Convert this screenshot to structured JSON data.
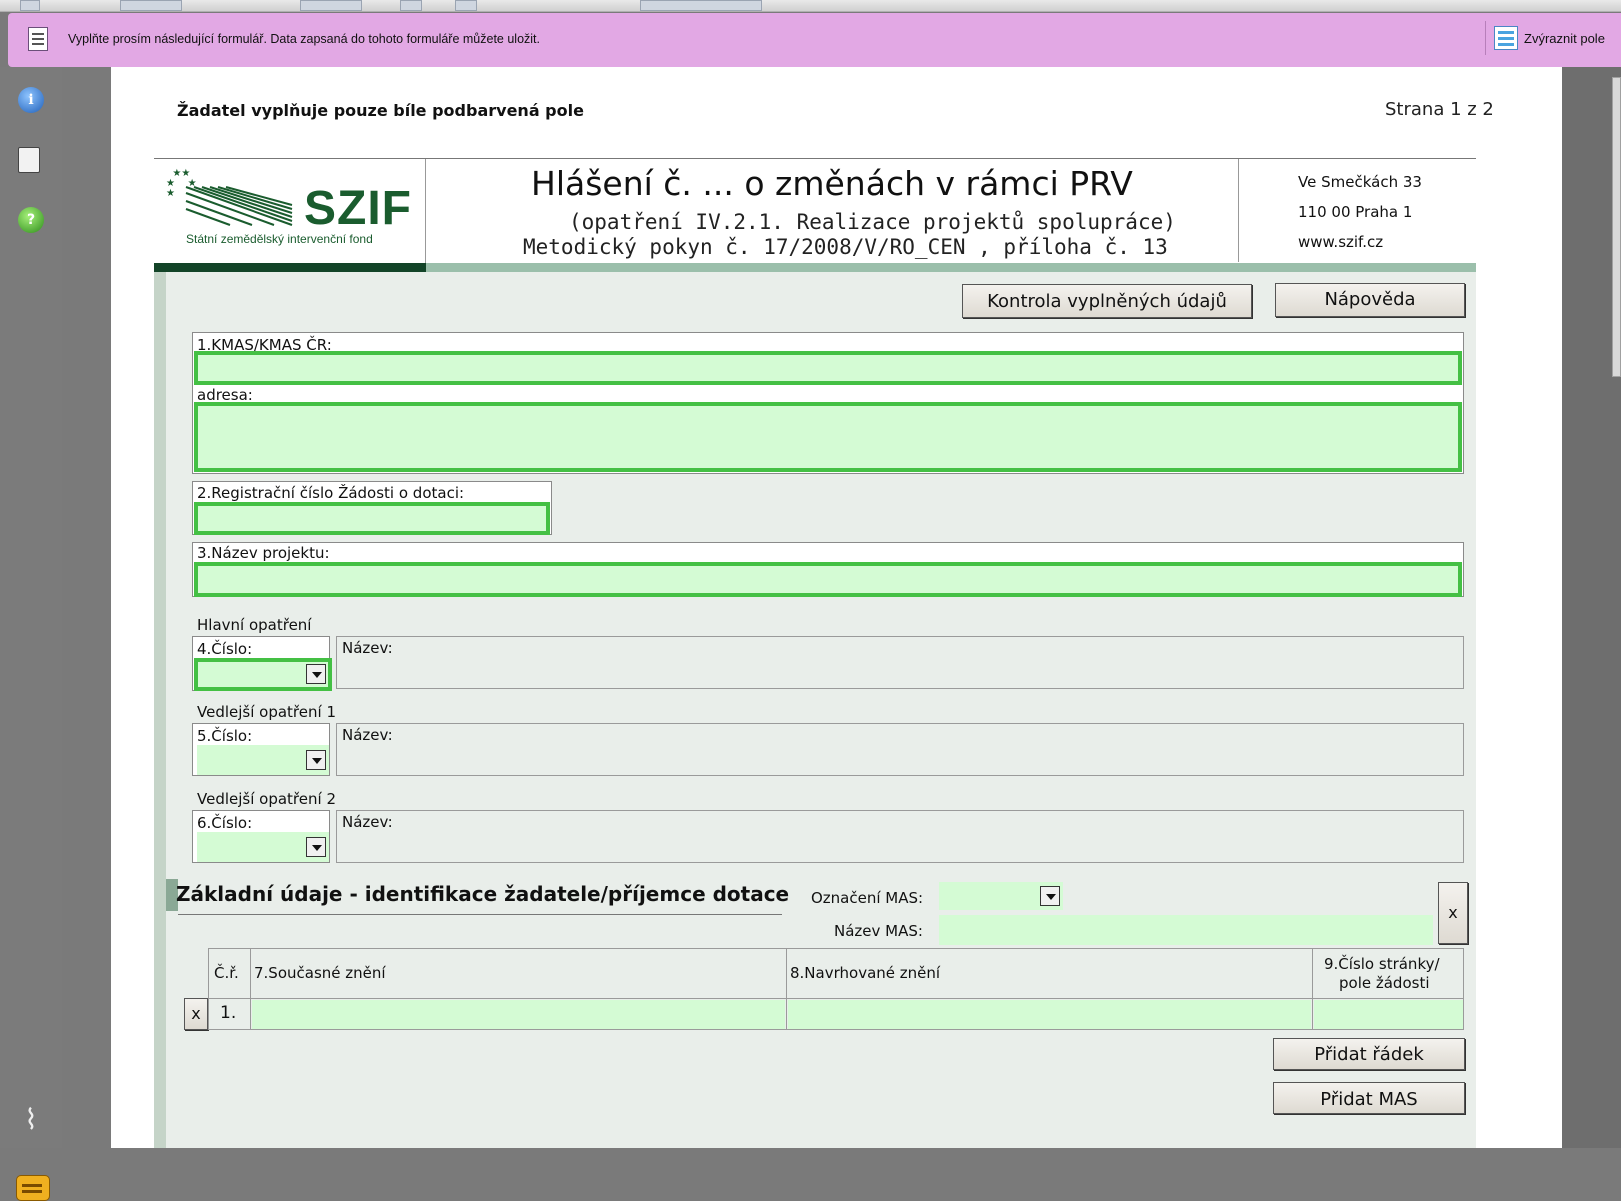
{
  "notice": {
    "text": "Vyplňte prosím následující formulář. Data zapsaná do tohoto formuláře můžete uložit.",
    "highlight_label": "Zvýraznit pole"
  },
  "page": {
    "note": "Žadatel vyplňuje pouze bíle podbarvená pole",
    "page_number": "Strana 1 z 2"
  },
  "logo": {
    "name": "SZIF",
    "subtitle": "Státní zemědělský intervenční fond"
  },
  "header": {
    "title": "Hlášení č. ... o změnách v rámci PRV",
    "subtitle1": "(opatření IV.2.1. Realizace projektů spolupráce)",
    "subtitle2": "Metodický pokyn č. 17/2008/V/RO_CEN , příloha č. 13",
    "address": [
      "Ve Smečkách 33",
      "110 00 Praha 1",
      "www.szif.cz"
    ]
  },
  "buttons": {
    "check": "Kontrola vyplněných údajů",
    "help": "Nápověda",
    "add_row": "Přidat řádek",
    "add_mas": "Přidat MAS",
    "remove_x": "x"
  },
  "fields": {
    "kmas": {
      "label": "1.KMAS/KMAS ČR:",
      "value": ""
    },
    "address": {
      "label": "adresa:",
      "value": ""
    },
    "reg_number": {
      "label": "2.Registrační číslo Žádosti o dotaci:",
      "value": ""
    },
    "project_name": {
      "label": "3.Název projektu:",
      "value": ""
    }
  },
  "measures": [
    {
      "group": "Hlavní opatření",
      "number_label": "4.Číslo:",
      "name_label": "Název:"
    },
    {
      "group": "Vedlejší opatření 1",
      "number_label": "5.Číslo:",
      "name_label": "Název:"
    },
    {
      "group": "Vedlejší opatření 2",
      "number_label": "6.Číslo:",
      "name_label": "Název:"
    }
  ],
  "section": {
    "title": "Základní údaje - identifikace žadatele/příjemce dotace",
    "mas_label": "Označení MAS:",
    "mas_name_label": "Název MAS:"
  },
  "table": {
    "headers": [
      "Č.ř.",
      "7.Současné znění",
      "8.Navrhované znění",
      "9.Číslo stránky/",
      "pole žádosti"
    ],
    "rows": [
      {
        "num": "1."
      }
    ]
  }
}
